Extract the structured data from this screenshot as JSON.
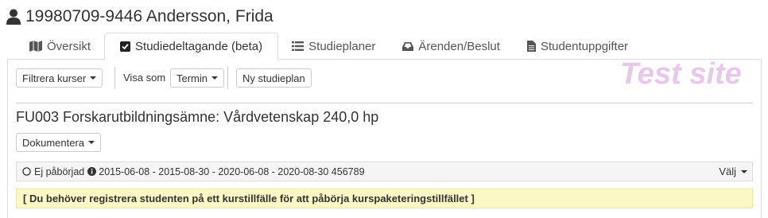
{
  "header": {
    "icon": "user-icon",
    "title": "19980709-9446 Andersson, Frida"
  },
  "tabs": [
    {
      "label": "Översikt",
      "icon": "map-icon",
      "active": false
    },
    {
      "label": "Studiedeltagande (beta)",
      "icon": "checkbox-icon",
      "active": true
    },
    {
      "label": "Studieplaner",
      "icon": "list-icon",
      "active": false
    },
    {
      "label": "Ärenden/Beslut",
      "icon": "inbox-icon",
      "active": false
    },
    {
      "label": "Studentuppgifter",
      "icon": "document-icon",
      "active": false
    }
  ],
  "toolbar": {
    "filter_label": "Filtrera kurser",
    "view_as_label": "Visa som",
    "view_as_value": "Termin",
    "new_plan_label": "Ny studieplan"
  },
  "watermark": "Test site",
  "course": {
    "title": "FU003 Forskarutbildningsämne: Vårdvetenskap 240,0 hp",
    "document_label": "Dokumentera"
  },
  "status": {
    "state": "Ej påbörjad",
    "details": "2015-06-08 - 2015-08-30 - 2020-06-08 - 2020-08-30 456789",
    "choose_label": "Välj"
  },
  "alert": "[ Du behöver registrera studenten på ett kurstillfälle för att påbörja kurspaketeringstillfället ]",
  "colors": {
    "alert_background": "#fcf8c5",
    "watermark": "#e8c8e8",
    "text": "#333333"
  }
}
